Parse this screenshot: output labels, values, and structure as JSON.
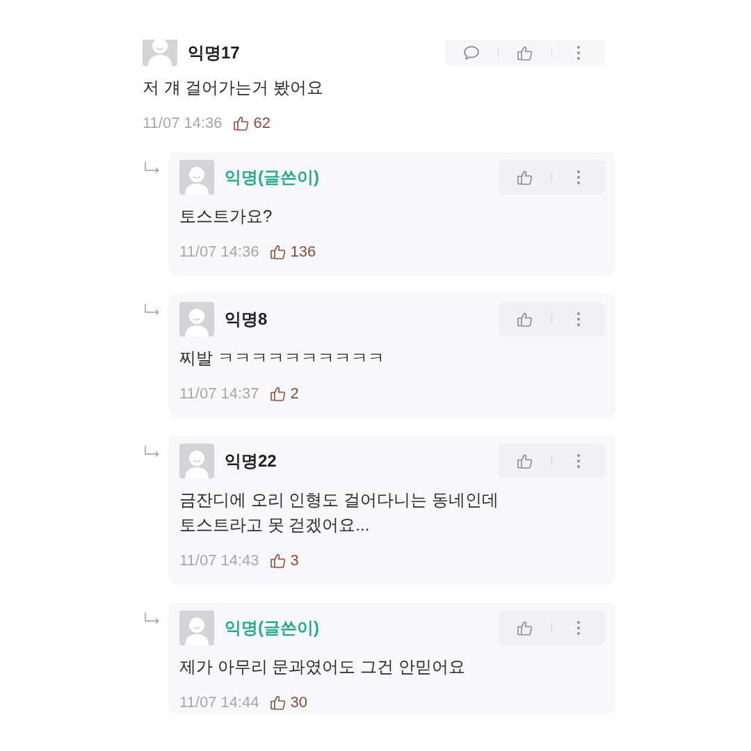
{
  "comments": [
    {
      "author": "익명17",
      "is_writer": false,
      "body": "저 걔 걸어가는거 봤어요",
      "time": "11/07 14:36",
      "likes": "62",
      "actions": [
        {
          "kind": "comment"
        },
        {
          "kind": "like"
        },
        {
          "kind": "more"
        }
      ],
      "replies": [
        {
          "author": "익명(글쓴이)",
          "is_writer": true,
          "body": "토스트가요?",
          "time": "11/07 14:36",
          "likes": "136",
          "actions": [
            {
              "kind": "like"
            },
            {
              "kind": "more"
            }
          ]
        },
        {
          "author": "익명8",
          "is_writer": false,
          "body": "찌발 ㅋㅋㅋㅋㅋㅋㅋㅋㅋㅋ",
          "time": "11/07 14:37",
          "likes": "2",
          "actions": [
            {
              "kind": "like"
            },
            {
              "kind": "more"
            }
          ]
        },
        {
          "author": "익명22",
          "is_writer": false,
          "body": "금잔디에 오리 인형도 걸어다니는 동네인데\n토스트라고 못 걷겠어요...",
          "time": "11/07 14:43",
          "likes": "3",
          "actions": [
            {
              "kind": "like"
            },
            {
              "kind": "more"
            }
          ]
        },
        {
          "author": "익명(글쓴이)",
          "is_writer": true,
          "body": "제가 아무리 문과였어도 그건 안믿어요",
          "time": "11/07 14:44",
          "likes": "30",
          "actions": [
            {
              "kind": "like"
            },
            {
              "kind": "more"
            }
          ]
        }
      ]
    }
  ]
}
